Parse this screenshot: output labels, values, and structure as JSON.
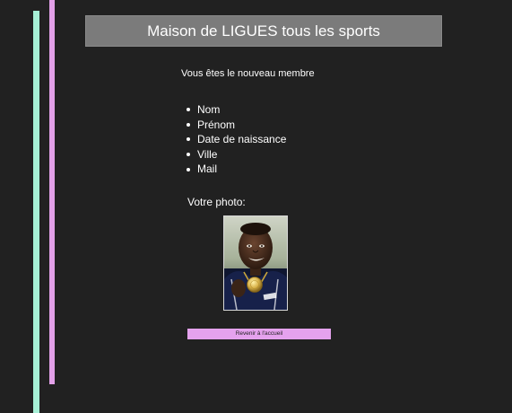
{
  "header": {
    "title": "Maison de LIGUES tous les sports"
  },
  "welcome": {
    "text": "Vous êtes le nouveau membre"
  },
  "fields": [
    "Nom",
    "Prénom",
    "Date de naissance",
    "Ville",
    "Mail"
  ],
  "photo": {
    "label": "Votre photo:",
    "subject": "athlete-with-gold-medal"
  },
  "actions": {
    "back_label": "Revenir à l'accueil"
  },
  "colors": {
    "background": "#212121",
    "mint_bar": "#a6efd6",
    "violet_bar": "#e2a0e8",
    "header_bg": "#7b7b7b",
    "button_bg": "#e5a2ee"
  }
}
